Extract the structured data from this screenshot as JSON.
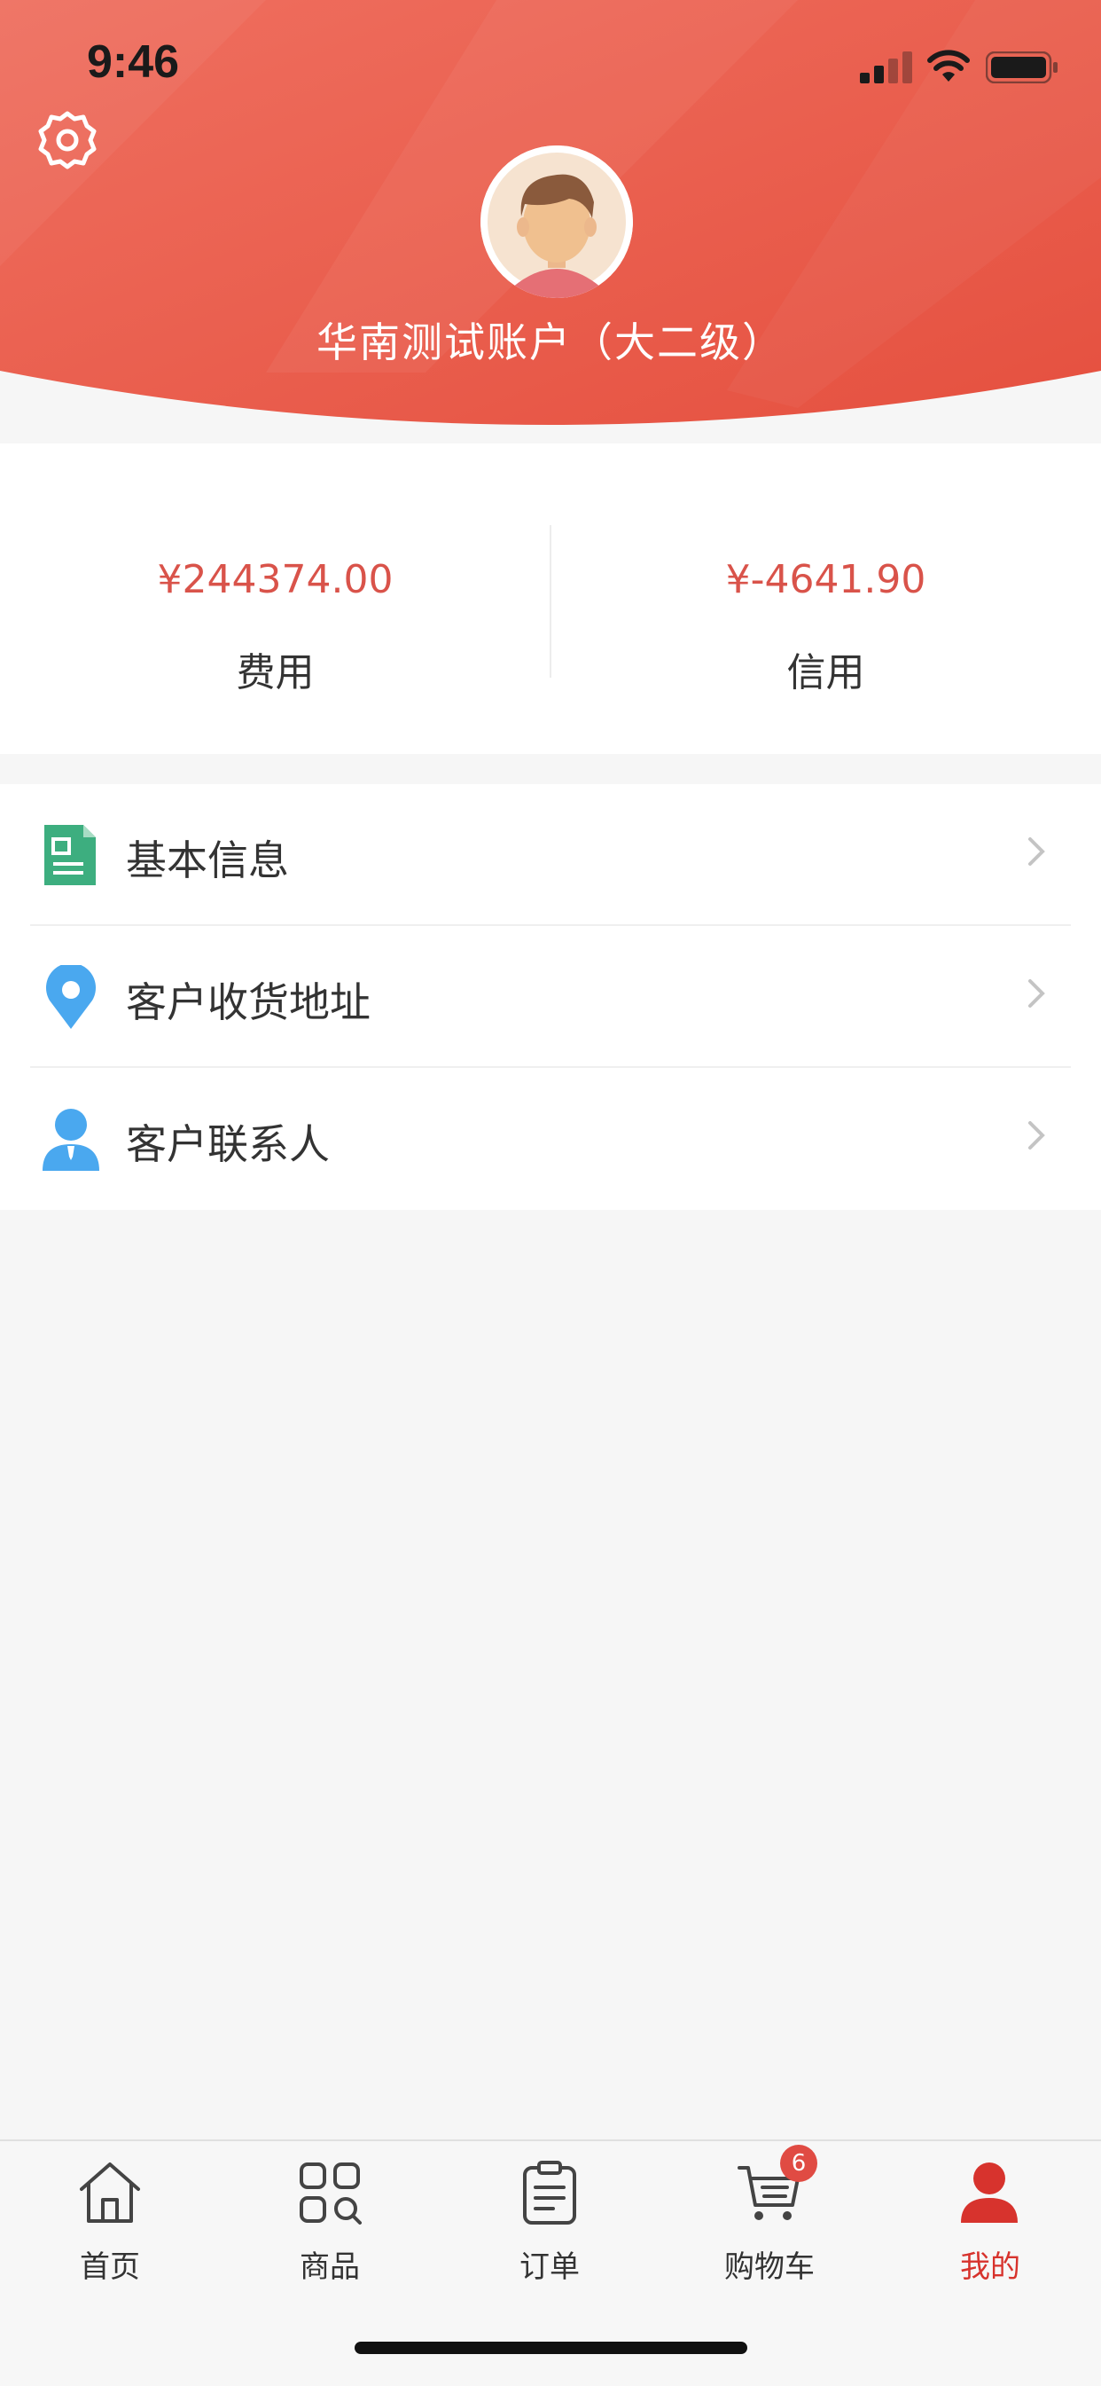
{
  "status_bar": {
    "time": "9:46"
  },
  "profile": {
    "account_name": "华南测试账户（大二级）"
  },
  "stats": {
    "fee": {
      "amount": "¥244374.00",
      "label": "费用"
    },
    "credit": {
      "amount": "¥-4641.90",
      "label": "信用"
    }
  },
  "menu": [
    {
      "label": "基本信息",
      "icon": "document-icon"
    },
    {
      "label": "客户收货地址",
      "icon": "location-pin-icon"
    },
    {
      "label": "客户联系人",
      "icon": "contact-person-icon"
    }
  ],
  "tabbar": {
    "tabs": [
      {
        "label": "首页",
        "icon": "home-icon"
      },
      {
        "label": "商品",
        "icon": "grid-icon"
      },
      {
        "label": "订单",
        "icon": "clipboard-icon"
      },
      {
        "label": "购物车",
        "icon": "cart-icon"
      },
      {
        "label": "我的",
        "icon": "user-icon",
        "active": true
      }
    ],
    "cart_badge": "6"
  },
  "colors": {
    "header_red": "#e8584a",
    "accent_red": "#d7332d",
    "amount_red": "#d9534a",
    "doc_green": "#3dae7f",
    "pin_blue": "#4aa8ef"
  }
}
